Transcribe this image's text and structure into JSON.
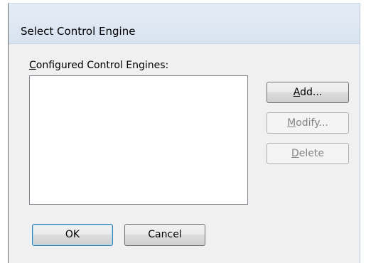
{
  "dialog": {
    "title": "Select Control Engine",
    "list_label": {
      "accel": "C",
      "rest": "onfigured Control Engines:"
    },
    "list_items": [],
    "buttons": {
      "add": {
        "accel": "A",
        "rest": "dd...",
        "enabled": true
      },
      "modify": {
        "accel": "M",
        "rest": "odify...",
        "enabled": false
      },
      "delete": {
        "accel": "D",
        "rest": "elete",
        "enabled": false
      },
      "ok": {
        "label": "OK",
        "default": true
      },
      "cancel": {
        "label": "Cancel"
      }
    }
  }
}
